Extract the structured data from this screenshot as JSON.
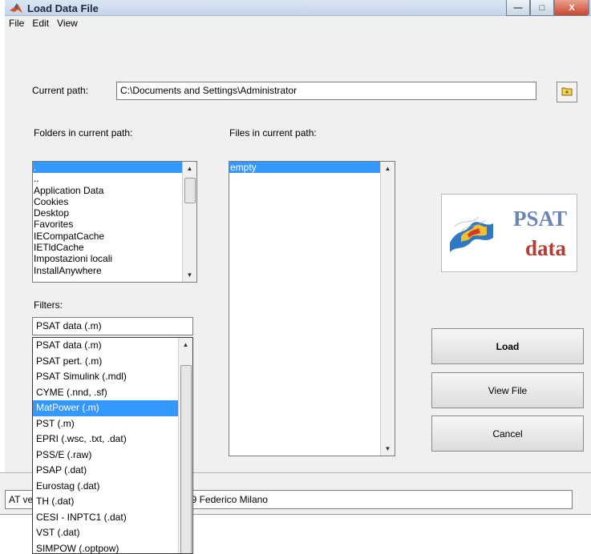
{
  "window": {
    "title": "Load Data File",
    "minimize_glyph": "—",
    "maximize_glyph": "□",
    "close_glyph": "X"
  },
  "menu": [
    "File",
    "Edit",
    "View"
  ],
  "current_path": {
    "label": "Current path:",
    "value": "C:\\Documents and Settings\\Administrator"
  },
  "folders": {
    "label": "Folders in current path:",
    "items": [
      ".",
      "..",
      "Application Data",
      "Cookies",
      "Desktop",
      "Favorites",
      "IECompatCache",
      "IETldCache",
      "Impostazioni locali",
      "InstallAnywhere"
    ],
    "selected_index": 0
  },
  "files": {
    "label": "Files in current path:",
    "items": [
      "empty"
    ],
    "selected_index": 0
  },
  "filters": {
    "label": "Filters:",
    "value": "PSAT data (.m)",
    "options": [
      "PSAT data (.m)",
      "PSAT pert. (.m)",
      "PSAT Simulink (.mdl)",
      "CYME (.nnd, .sf)",
      "MatPower (.m)",
      "PST (.m)",
      "EPRI (.wsc, .txt, .dat)",
      "PSS/E (.raw)",
      "PSAP (.dat)",
      "Eurostag (.dat)",
      "TH (.dat)",
      "CESI - INPTC1 (.dat)",
      "VST (.dat)",
      "SIMPOW (.optpow)"
    ],
    "highlighted_index": 4
  },
  "logo": {
    "line1": "PSAT",
    "line2": "data",
    "color_line1": "#6b85b5",
    "color_line2": "#b43d35"
  },
  "buttons": {
    "load": "Load",
    "view_file": "View File",
    "cancel": "Cancel"
  },
  "status": {
    "left": "AT ve",
    "right": "009 Federico Milano"
  }
}
